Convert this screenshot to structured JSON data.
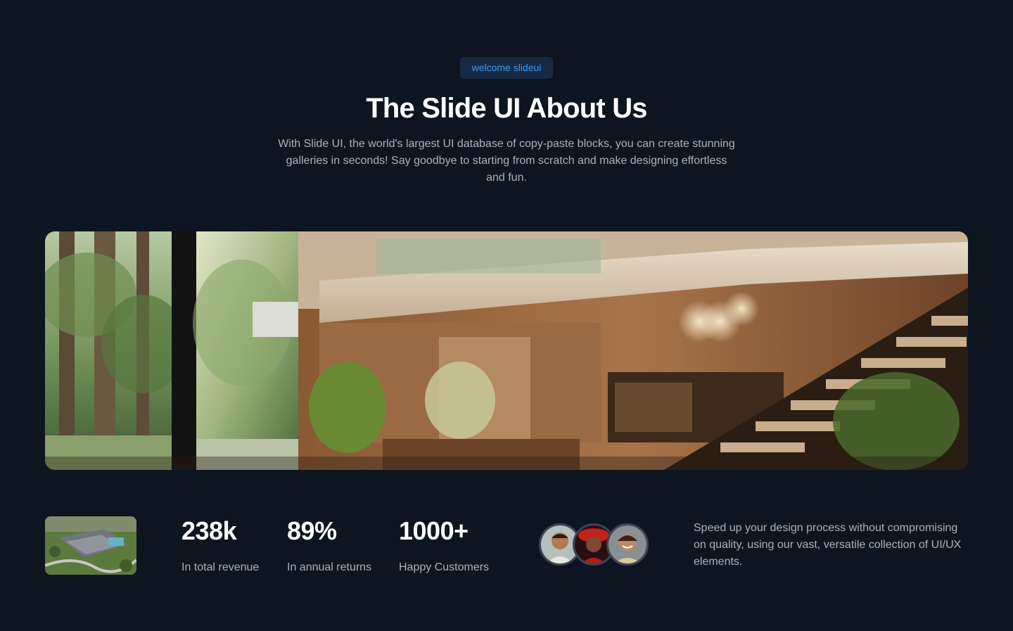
{
  "badge": "welcome slideui",
  "title": "The Slide UI About Us",
  "subtitle": "With Slide UI, the world's largest UI database of copy-paste blocks, you can create stunning galleries in seconds! Say goodbye to starting from scratch and make designing effortless and fun.",
  "hero": {
    "image": "modern-house-interior-photo"
  },
  "thumbnail": {
    "image": "aerial-house-photo"
  },
  "stats": [
    {
      "value": "238k",
      "label": "In total revenue"
    },
    {
      "value": "89%",
      "label": "In annual returns"
    },
    {
      "value": "1000+",
      "label": "Happy Customers"
    }
  ],
  "avatars": [
    {
      "image": "customer-avatar-man"
    },
    {
      "image": "customer-avatar-woman-red-hat"
    },
    {
      "image": "customer-avatar-woman-smiling"
    }
  ],
  "blurb": "Speed up your design process without compromising on quality, using our vast, versatile collection of UI/UX elements.",
  "colors": {
    "background": "#0d1520",
    "badge_bg": "#172a45",
    "badge_text": "#3b9cf0",
    "muted_text": "#aab1bd"
  }
}
